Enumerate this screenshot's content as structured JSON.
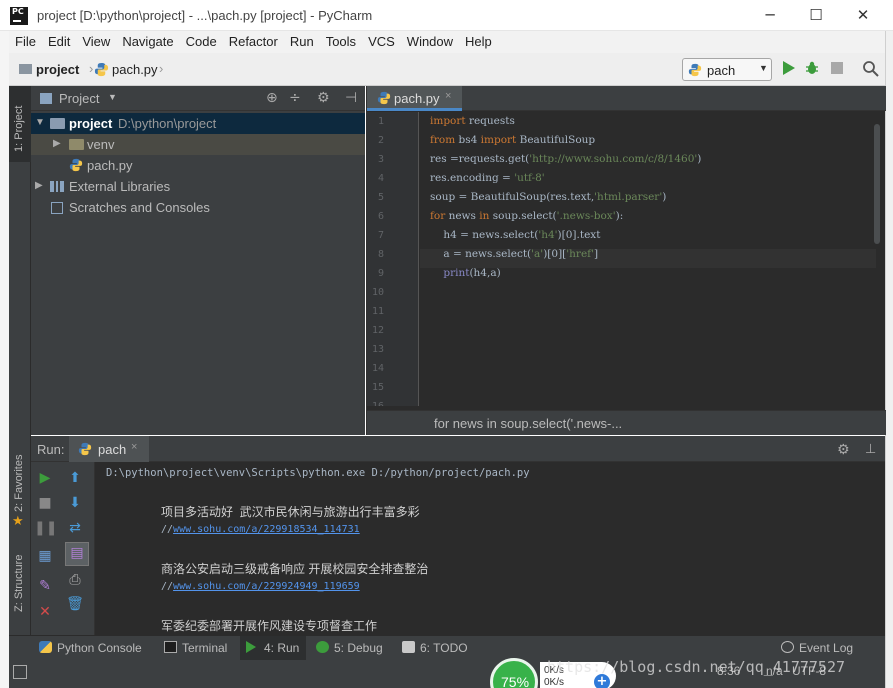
{
  "window": {
    "title": "project [D:\\python\\project] - ...\\pach.py [project] - PyCharm",
    "min_glyph": "─",
    "max_glyph": "☐",
    "close_glyph": "✕",
    "app_icon_label": "PC"
  },
  "menubar": {
    "items": [
      "File",
      "Edit",
      "View",
      "Navigate",
      "Code",
      "Refactor",
      "Run",
      "Tools",
      "VCS",
      "Window",
      "Help"
    ]
  },
  "navbar": {
    "project": "project",
    "file": "pach.py",
    "separator": "›",
    "run_config": "pach",
    "run_config_caret": "▼"
  },
  "left_strip": {
    "project_tab": "1: Project",
    "favorites_tab": "2: Favorites",
    "structure_tab": "Z: Structure"
  },
  "project_panel": {
    "header_label": "Project",
    "header_caret": "▼",
    "header_icons": [
      "⊕",
      "÷",
      "⚙",
      "⊣"
    ],
    "tree": {
      "project_name": "project",
      "project_path": "D:\\python\\project",
      "venv": "venv",
      "pach": "pach.py",
      "ext_libs": "External Libraries",
      "scratches": "Scratches and Consoles"
    }
  },
  "editor": {
    "tab_label": "pach.py",
    "tab_close": "×",
    "line_numbers": [
      "1",
      "2",
      "3",
      "4",
      "5",
      "6",
      "7",
      "8",
      "9",
      "10",
      "11",
      "12",
      "13",
      "14",
      "15",
      "16"
    ],
    "code": {
      "l1_kw": "import",
      "l1_rest": " requests",
      "l2_kw1": "from",
      "l2_mid": " bs4 ",
      "l2_kw2": "import",
      "l2_rest": " BeautifulSoup",
      "l3_a": "res =requests.get(",
      "l3_str": "'http://www.sohu.com/c/8/1460'",
      "l3_b": ")",
      "l4_a": "res.encoding = ",
      "l4_str": "'utf-8'",
      "l5_a": "soup = BeautifulSoup(res.text,",
      "l5_str": "'html.parser'",
      "l5_b": ")",
      "l6_kw1": "for",
      "l6_a": " news ",
      "l6_kw2": "in",
      "l6_b": " soup.select(",
      "l6_str": "'.news-box'",
      "l6_c": "):",
      "l7_a": "    h4 = news.select(",
      "l7_str": "'h4'",
      "l7_b": ")[0].text",
      "l8_a": "    a = news.select(",
      "l8_str1": "'a'",
      "l8_b": ")[0][",
      "l8_str2": "'href'",
      "l8_c": "]",
      "l9_bi": "    print",
      "l9_a": "(h4,a)"
    },
    "breadcrumb": "for news in soup.select('.news-..."
  },
  "run_panel": {
    "header_label": "Run:",
    "tab_label": "pach",
    "tab_close": "×",
    "gear": "⚙",
    "pin": "⊥",
    "console": {
      "command": "D:\\python\\project\\venv\\Scripts\\python.exe D:/python/project/pach.py",
      "entries": [
        {
          "title": "项目多活动好  武汉市民休闲与旅游出行丰富多彩",
          "prefix": "//",
          "link": "www.sohu.com/a/229918534_114731"
        },
        {
          "title": "商洛公安启动三级戒备响应 开展校园安全排查整治",
          "prefix": "//",
          "link": "www.sohu.com/a/229924949_119659"
        },
        {
          "title": "军委纪委部署开展作风建设专项督查工作",
          "prefix": "",
          "link": ""
        }
      ]
    }
  },
  "bottom_bar": {
    "python_console": "Python Console",
    "terminal": "Terminal",
    "run": "4: Run",
    "debug": "5: Debug",
    "todo": "6: TODO",
    "event_log": "Event Log"
  },
  "status_bar": {
    "position": "8:36",
    "line_sep": "n/a",
    "encoding": "UTF-8"
  },
  "overlays": {
    "watermark": "https://blog.csdn.net/qq_41777527",
    "net_pct": "75%",
    "net_up": "0K/s",
    "net_down": "0K/s",
    "net_plus": "+"
  },
  "colors": {
    "editor_bg": "#2b2b2b",
    "panel_bg": "#3c3f41",
    "keyword": "#cc7832",
    "string": "#6a8759",
    "link": "#5394ec",
    "run_green": "#3c9c3c"
  }
}
